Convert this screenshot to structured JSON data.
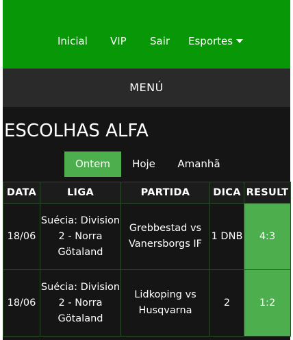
{
  "nav": {
    "items": [
      "Inicial",
      "VIP",
      "Sair"
    ],
    "dropdown_label": "Esportes"
  },
  "menu": {
    "label": "MENÚ"
  },
  "page": {
    "title": "ESCOLHAS ALFA"
  },
  "tabs": [
    {
      "label": "Ontem",
      "active": true
    },
    {
      "label": "Hoje",
      "active": false
    },
    {
      "label": "Amanhã",
      "active": false
    }
  ],
  "table": {
    "headers": [
      "DATA",
      "LIGA",
      "PARTIDA",
      "DICA",
      "RESULT"
    ],
    "rows": [
      {
        "data": "18/06",
        "liga": "Suécia: Division 2 - Norra Götaland",
        "partida": "Grebbestad vs Vanersborgs IF",
        "dica": "1 DNB",
        "result": "4:3"
      },
      {
        "data": "18/06",
        "liga": "Suécia: Division 2 - Norra Götaland",
        "partida": "Lidkoping vs Husqvarna",
        "dica": "2",
        "result": "1:2"
      }
    ]
  },
  "colors": {
    "nav_bg": "#079707",
    "accent": "#4cae4c",
    "menubar_bg": "#2a2a2a",
    "page_bg": "#151515"
  }
}
